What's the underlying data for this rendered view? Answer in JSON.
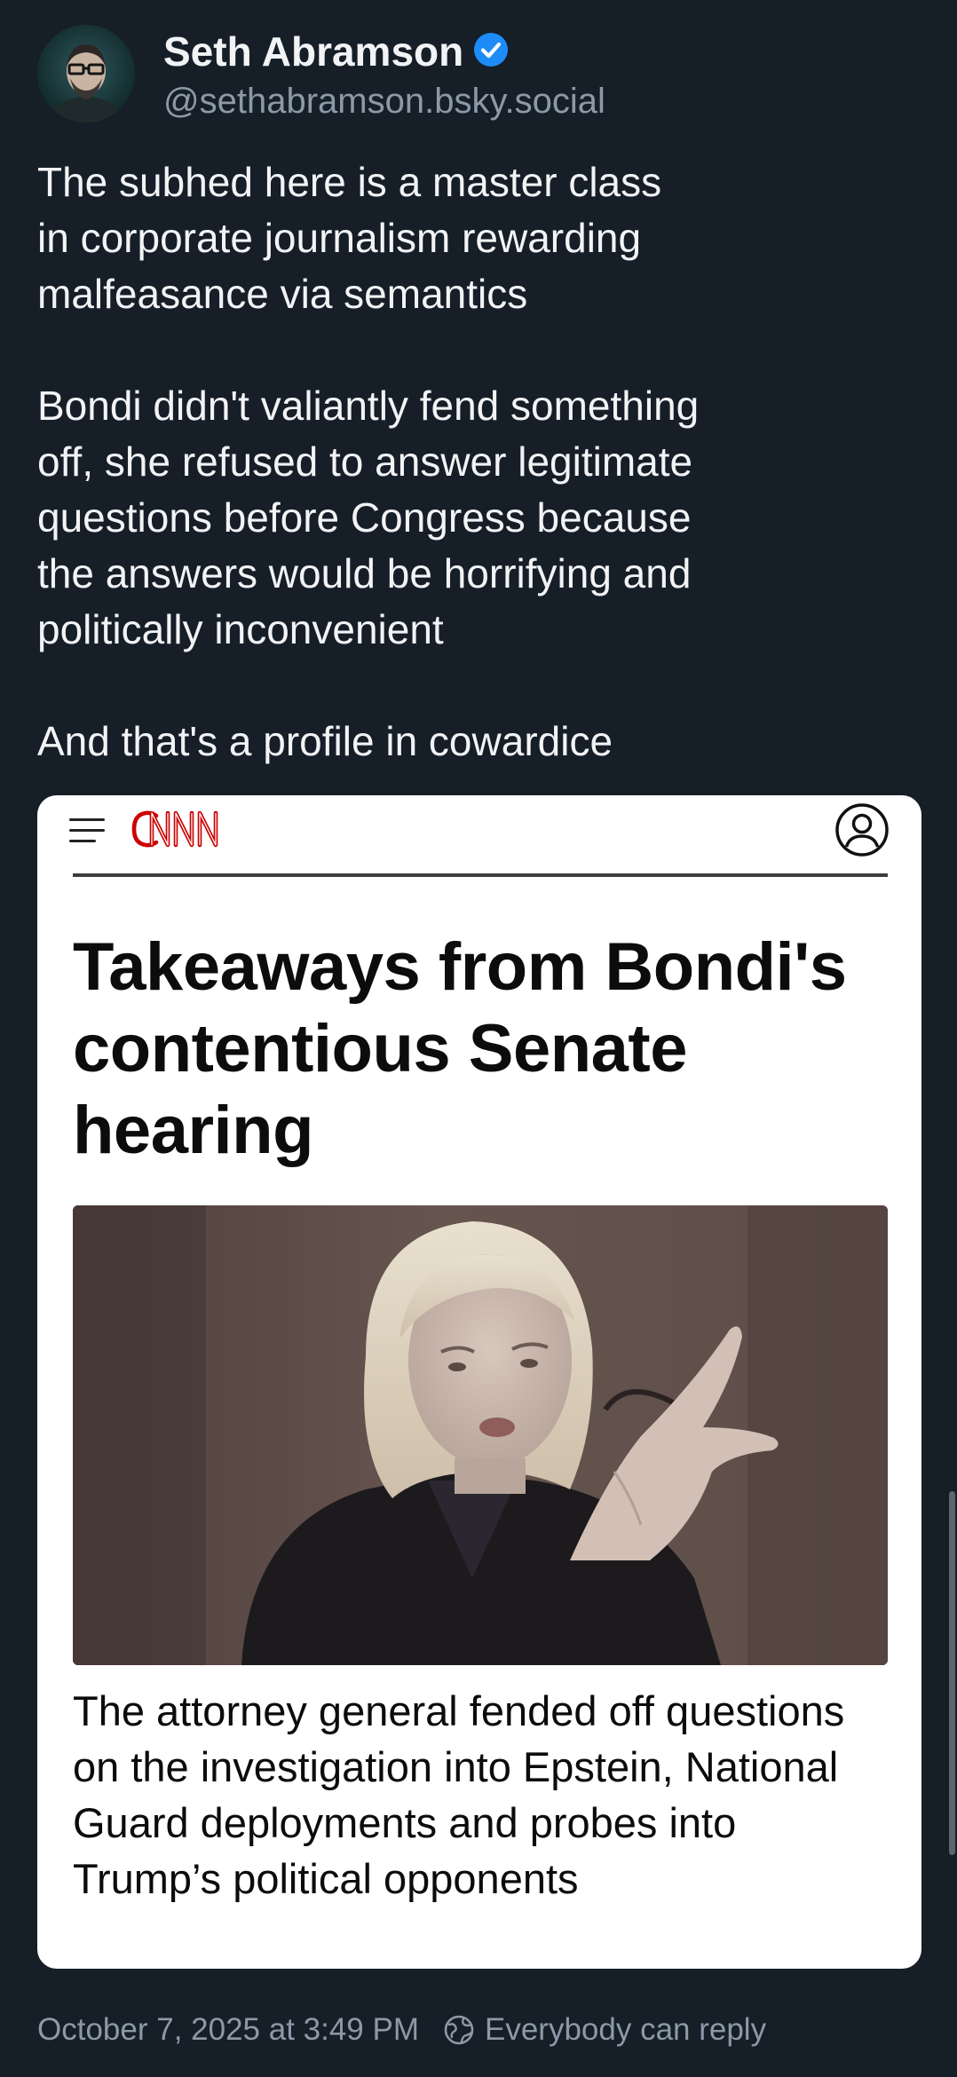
{
  "author": {
    "name": "Seth Abramson",
    "handle": "@sethabramson.bsky.social",
    "verified": true
  },
  "post": {
    "paragraphs": [
      "The subhed here is a master class\nin corporate journalism rewarding\nmalfeasance via semantics",
      "Bondi didn't valiantly fend something\noff, she refused to answer legitimate\nquestions before Congress because\nthe answers would be horrifying and\npolitically inconvenient",
      "And that's a profile in cowardice"
    ]
  },
  "embed": {
    "brand": "CNN",
    "headline": "Takeaways from Bondi's contentious Senate hearing",
    "subhead": "The attorney general fended off questions on the investigation into Epstein, National Guard deployments and probes into Trump’s political opponents"
  },
  "footer": {
    "timestamp": "October 7, 2025 at 3:49 PM",
    "reply_setting": "Everybody can reply"
  },
  "colors": {
    "background": "#161e27",
    "text": "#f1f3f5",
    "muted": "#8c99a8",
    "verified": "#1d8cf8",
    "cnn_red": "#cc0000"
  },
  "icons": [
    "menu-icon",
    "user-circle-icon",
    "verified-check-icon",
    "globe-icon"
  ]
}
